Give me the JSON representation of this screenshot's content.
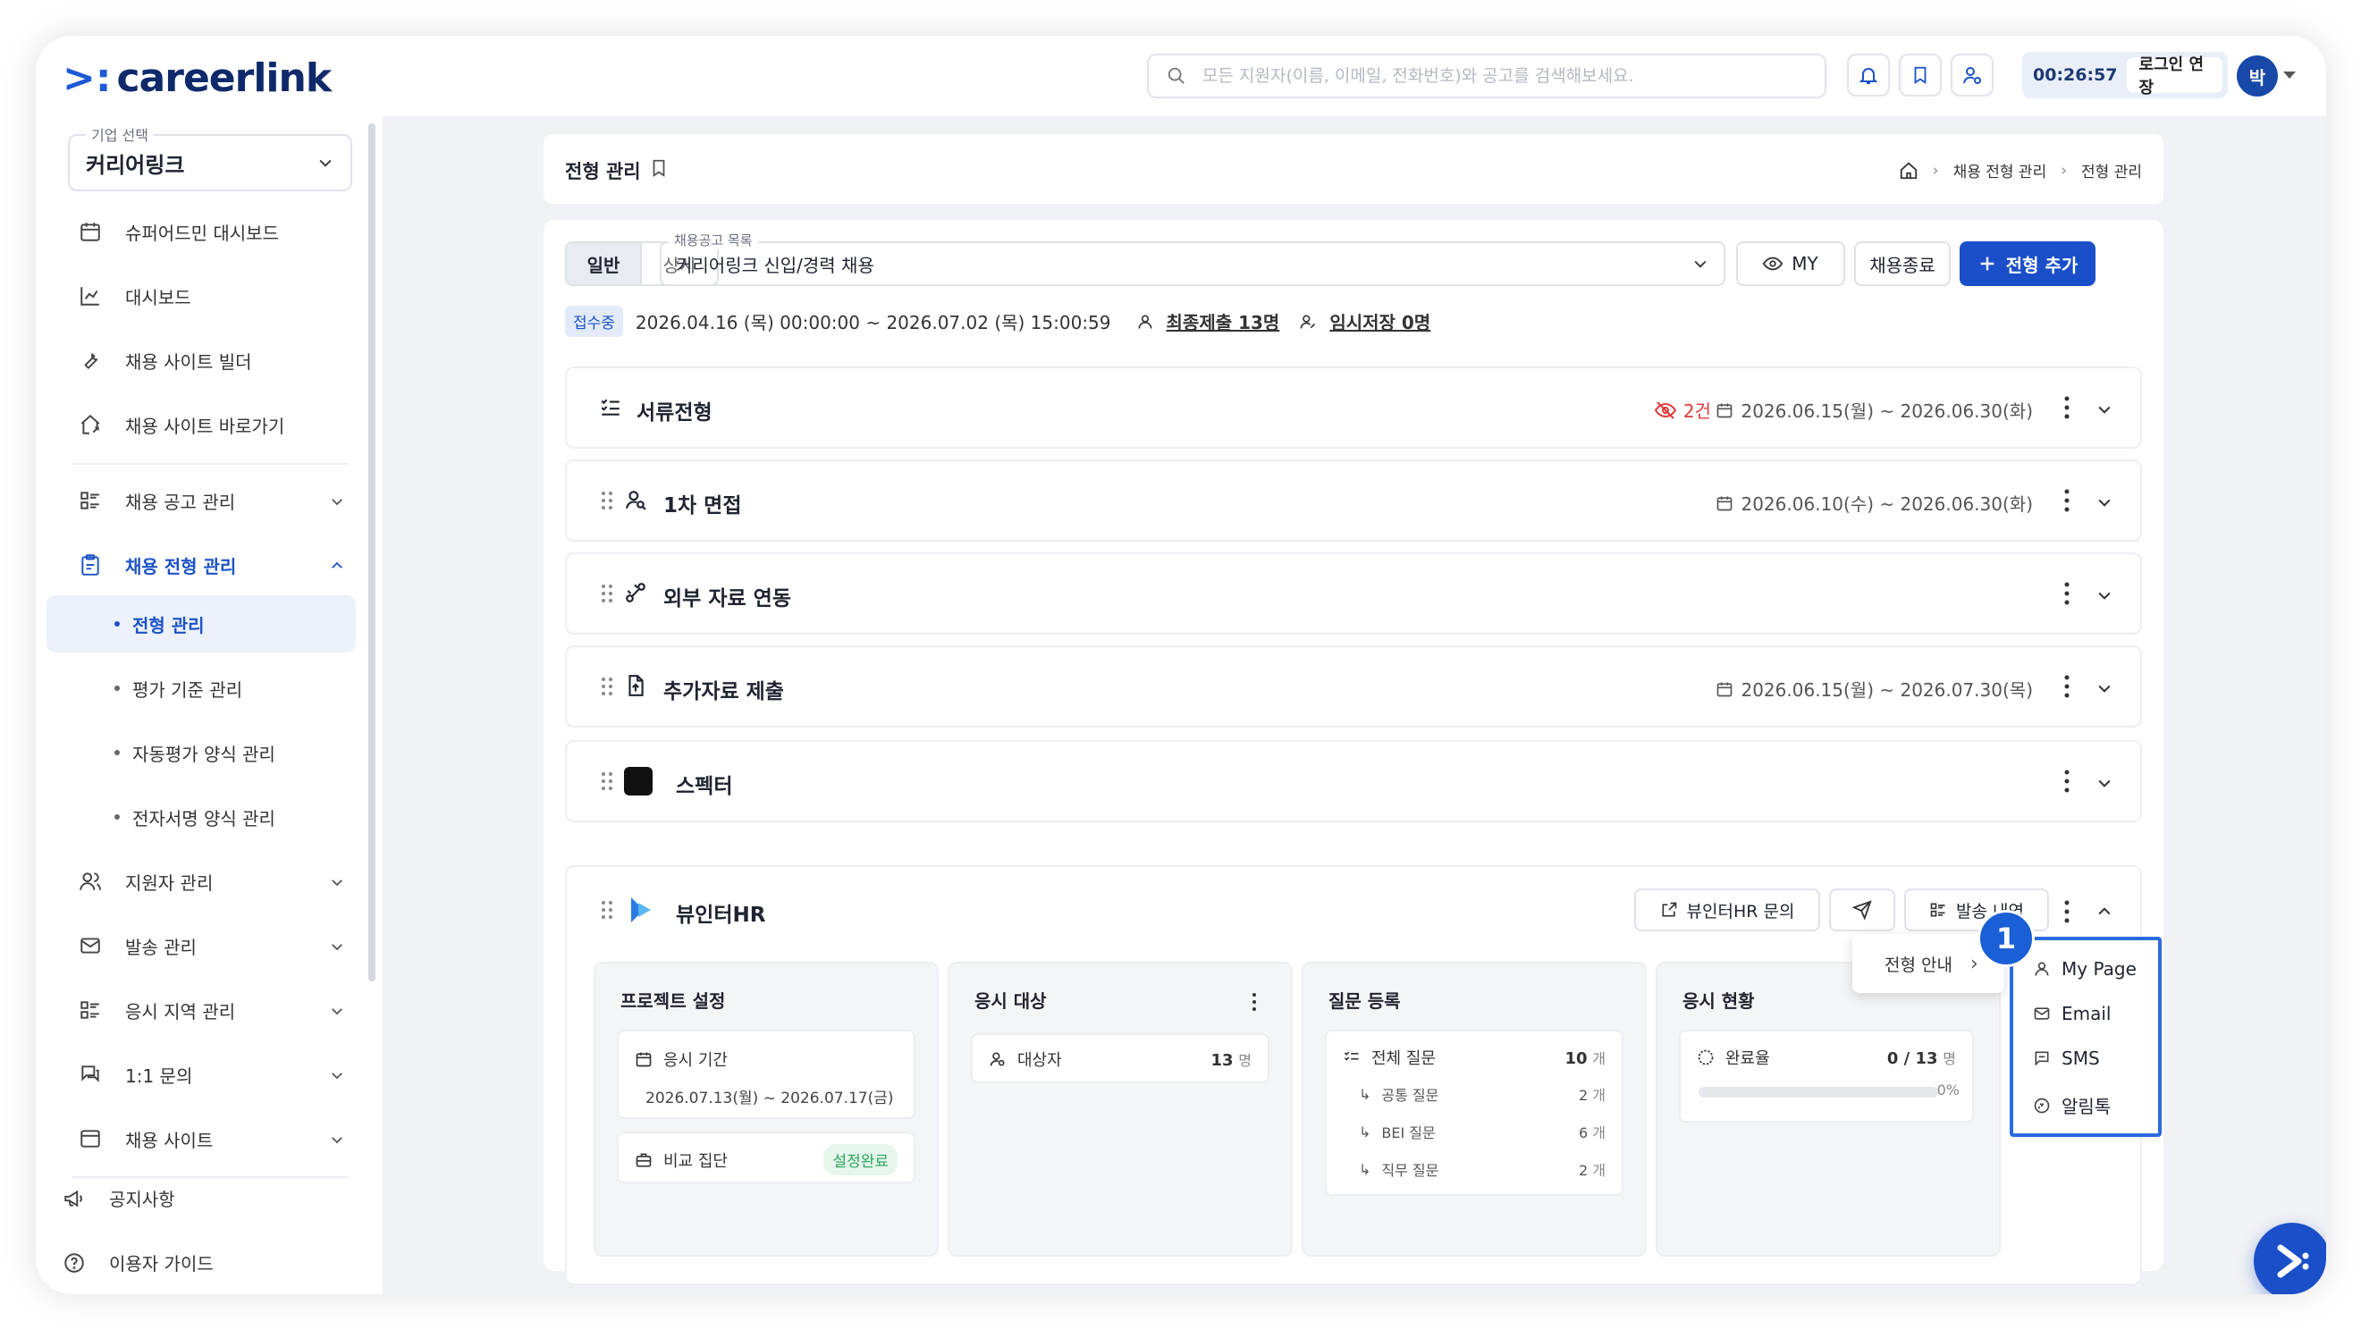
{
  "app": {
    "logo_text": "careerlink",
    "logo_mark": ">:"
  },
  "topbar": {
    "search_placeholder": "모든 지원자(이름, 이메일, 전화번호)와 공고를 검색해보세요.",
    "session_time": "00:26:57",
    "extend_label": "로그인 연장",
    "avatar": "박"
  },
  "sidebar": {
    "company_label": "기업 선택",
    "company_value": "커리어링크",
    "items": [
      {
        "label": "슈퍼어드민 대시보드",
        "icon": "calendar-icon"
      },
      {
        "label": "대시보드",
        "icon": "chart-icon"
      },
      {
        "label": "채용 사이트 빌더",
        "icon": "tool-icon"
      },
      {
        "label": "채용 사이트 바로가기",
        "icon": "home-icon"
      },
      {
        "label": "채용 공고 관리",
        "icon": "list-icon"
      },
      {
        "label": "채용 전형 관리",
        "icon": "clipboard-icon"
      },
      {
        "label": "지원자 관리",
        "icon": "users-icon"
      },
      {
        "label": "발송 관리",
        "icon": "mail-icon"
      },
      {
        "label": "응시 지역 관리",
        "icon": "list-icon"
      },
      {
        "label": "1:1 문의",
        "icon": "chat-icon"
      },
      {
        "label": "채용 사이트",
        "icon": "window-icon"
      }
    ],
    "subitems": [
      "전형 관리",
      "평가 기준 관리",
      "자동평가 양식 관리",
      "전자서명 양식 관리"
    ],
    "bottom": [
      {
        "label": "공지사항"
      },
      {
        "label": "이용자 가이드"
      }
    ]
  },
  "header": {
    "title": "전형 관리",
    "breadcrumb": [
      "채용 전형 관리",
      "전형 관리"
    ]
  },
  "toolbar": {
    "seg": [
      "일반",
      "상시"
    ],
    "job_label": "채용공고 목록",
    "job_value": "커리어링크 신입/경력 채용",
    "my_label": "MY",
    "close_label": "채용종료",
    "add_label": "전형 추가"
  },
  "status": {
    "badge": "접수중",
    "period": "2026.04.16 (목) 00:00:00 ~ 2026.07.02 (목) 15:00:59",
    "final": "최종제출 13명",
    "temp": "임시저장 0명"
  },
  "steps": [
    {
      "name": "서류전형",
      "hidden": "2건",
      "date": "2026.06.15(월) ~ 2026.06.30(화)"
    },
    {
      "name": "1차 면접",
      "date": "2026.06.10(수) ~ 2026.06.30(화)"
    },
    {
      "name": "외부 자료 연동"
    },
    {
      "name": "추가자료 제출",
      "date": "2026.06.15(월) ~ 2026.07.30(목)"
    },
    {
      "name": "스펙터"
    }
  ],
  "viewinter": {
    "name": "뷰인터HR",
    "inquiry_label": "뷰인터HR 문의",
    "history_label": "발송 내역",
    "cards": {
      "project": {
        "title": "프로젝트 설정",
        "period_label": "응시 기간",
        "period": "2026.07.13(월) ~ 2026.07.17(금)",
        "group_label": "비교 집단",
        "group_status": "설정완료"
      },
      "target": {
        "title": "응시 대상",
        "label": "대상자",
        "count": "13",
        "unit": "명"
      },
      "questions": {
        "title": "질문 등록",
        "rows": [
          {
            "label": "전체 질문",
            "count": "10",
            "unit": "개"
          },
          {
            "label": "공통 질문",
            "count": "2",
            "unit": "개"
          },
          {
            "label": "BEI 질문",
            "count": "6",
            "unit": "개"
          },
          {
            "label": "직무 질문",
            "count": "2",
            "unit": "개"
          }
        ]
      },
      "status": {
        "title": "응시 현황",
        "label": "완료율",
        "value": "0 / 13",
        "unit": "명",
        "percent": "0%",
        "progress": 0
      }
    }
  },
  "popover": {
    "label": "전형 안내"
  },
  "send_menu": {
    "items": [
      "My Page",
      "Email",
      "SMS",
      "알림톡"
    ]
  },
  "callout": "1",
  "colors": {
    "primary": "#1a4fc9",
    "accent_blue": "#1c53c7",
    "danger": "#e03a3a",
    "success": "#2aa55a"
  }
}
